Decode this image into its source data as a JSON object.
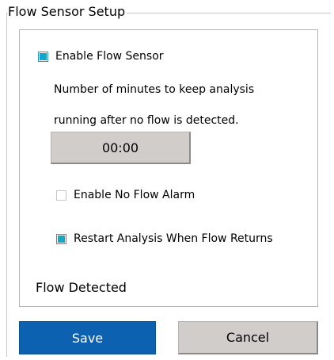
{
  "group": {
    "title": "Flow Sensor Setup"
  },
  "enable_flow_sensor": {
    "label": "Enable Flow Sensor",
    "checked": true
  },
  "description": {
    "line1": "Number of minutes to keep analysis",
    "line2": "running after no flow is detected."
  },
  "time_value": "00:00",
  "enable_no_flow_alarm": {
    "label": "Enable No Flow Alarm",
    "checked": false
  },
  "restart_analysis": {
    "label": "Restart Analysis When Flow Returns",
    "checked": true
  },
  "status": {
    "text": "Flow Detected"
  },
  "buttons": {
    "save": "Save",
    "cancel": "Cancel"
  },
  "colors": {
    "check_accent": "#13a7cf",
    "save_bg": "#0c61b0",
    "button_gray": "#d0cdcb"
  }
}
